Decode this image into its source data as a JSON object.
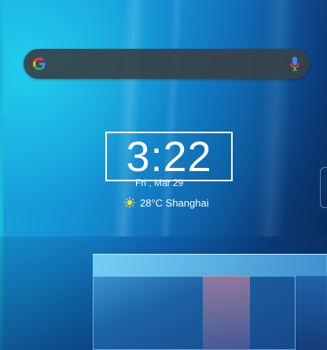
{
  "clock": {
    "time": "3:22"
  },
  "date": {
    "text": "Fri , Mar 29"
  },
  "weather": {
    "text": "28°C Shanghai",
    "icon": "sun-icon"
  },
  "search": {
    "logo": "google-icon",
    "voice": "mic-icon"
  },
  "colors": {
    "search_bg": "#37414B",
    "google_blue": "#4285F4",
    "google_red": "#EA4335",
    "google_yellow": "#FBBC05",
    "google_green": "#34A853",
    "sun": "#FFD23C"
  }
}
